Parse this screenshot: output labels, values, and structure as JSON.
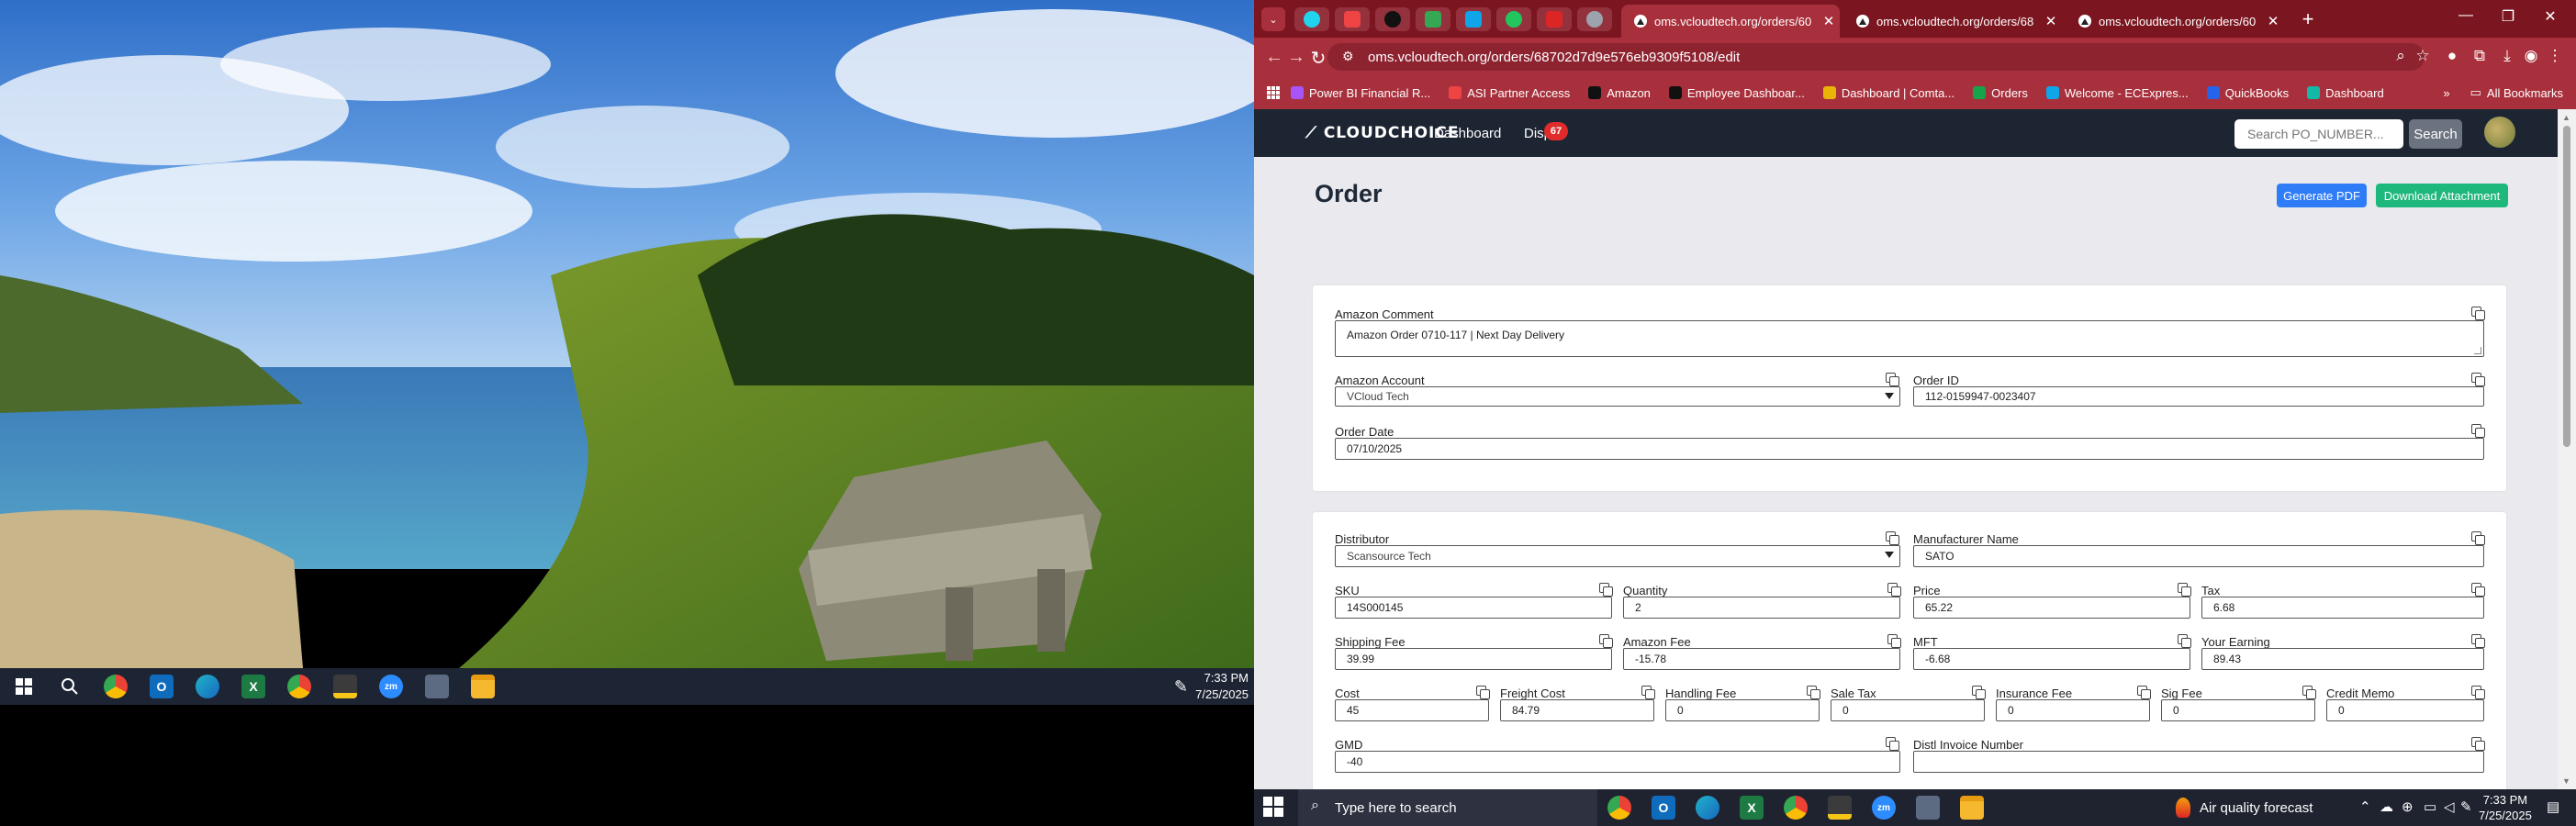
{
  "left_taskbar": {
    "time": "7:33 PM",
    "date": "7/25/2025"
  },
  "browser": {
    "tabs": [
      {
        "title": "oms.vcloudtech.org/orders/60",
        "active": true
      },
      {
        "title": "oms.vcloudtech.org/orders/68",
        "active": false
      },
      {
        "title": "oms.vcloudtech.org/orders/60",
        "active": false
      }
    ],
    "url": "oms.vcloudtech.org/orders/68702d7d9e576eb9309f5108/edit",
    "bookmarks": [
      {
        "label": "Power BI Financial R...",
        "color": "#a855f7"
      },
      {
        "label": "ASI Partner Access",
        "color": "#ef4444"
      },
      {
        "label": "Amazon",
        "color": "#111111"
      },
      {
        "label": "Employee Dashboar...",
        "color": "#111111"
      },
      {
        "label": "Dashboard | Comta...",
        "color": "#eab308"
      },
      {
        "label": "Orders",
        "color": "#16a34a"
      },
      {
        "label": "Welcome - ECExpres...",
        "color": "#0ea5e9"
      },
      {
        "label": "QuickBooks",
        "color": "#2563eb"
      },
      {
        "label": "Dashboard",
        "color": "#14b8a6"
      }
    ],
    "all_bookmarks": "All Bookmarks"
  },
  "app": {
    "logo": "CLOUDCHOICE",
    "nav": {
      "dashboard": "Dashboard",
      "disputes": "Dispu",
      "disputes_count": "67"
    },
    "search": {
      "placeholder": "Search PO_NUMBER...",
      "button": "Search"
    }
  },
  "page": {
    "title": "Order",
    "generate_pdf": "Generate PDF",
    "download_attachment": "Download Attachment"
  },
  "order": {
    "amazon_comment": {
      "label": "Amazon Comment",
      "value": "Amazon Order 0710-117 | Next Day Delivery"
    },
    "amazon_account": {
      "label": "Amazon Account",
      "value": "VCloud Tech"
    },
    "order_id": {
      "label": "Order ID",
      "value": "112-0159947-0023407"
    },
    "order_date": {
      "label": "Order Date",
      "value": "07/10/2025"
    }
  },
  "item": {
    "distributor": {
      "label": "Distributor",
      "value": "Scansource Tech"
    },
    "manufacturer": {
      "label": "Manufacturer Name",
      "value": "SATO"
    },
    "sku": {
      "label": "SKU",
      "value": "14S000145"
    },
    "quantity": {
      "label": "Quantity",
      "value": "2"
    },
    "price": {
      "label": "Price",
      "value": "65.22"
    },
    "tax": {
      "label": "Tax",
      "value": "6.68"
    },
    "shipping_fee": {
      "label": "Shipping Fee",
      "value": "39.99"
    },
    "amazon_fee": {
      "label": "Amazon Fee",
      "value": "-15.78"
    },
    "mft": {
      "label": "MFT",
      "value": "-6.68"
    },
    "your_earning": {
      "label": "Your Earning",
      "value": "89.43"
    },
    "cost": {
      "label": "Cost",
      "value": "45"
    },
    "freight_cost": {
      "label": "Freight Cost",
      "value": "84.79"
    },
    "handling_fee": {
      "label": "Handling Fee",
      "value": "0"
    },
    "sale_tax": {
      "label": "Sale Tax",
      "value": "0"
    },
    "insurance_fee": {
      "label": "Insurance Fee",
      "value": "0"
    },
    "sig_fee": {
      "label": "Sig Fee",
      "value": "0"
    },
    "credit_memo": {
      "label": "Credit Memo",
      "value": "0"
    },
    "gmd": {
      "label": "GMD",
      "value": "-40"
    },
    "distl_invoice_number": {
      "label": "Distl Invoice Number",
      "value": ""
    }
  },
  "right_taskbar": {
    "search_placeholder": "Type here to search",
    "weather": "Air quality forecast",
    "time": "7:33 PM",
    "date": "7/25/2025"
  },
  "colors": {
    "browser_frame": "#7b1620",
    "browser_active": "#a8303c",
    "app_nav": "#1d2533",
    "primary_button": "#2f7df6",
    "success_button": "#1fb87c",
    "badge": "#e12b2b"
  }
}
